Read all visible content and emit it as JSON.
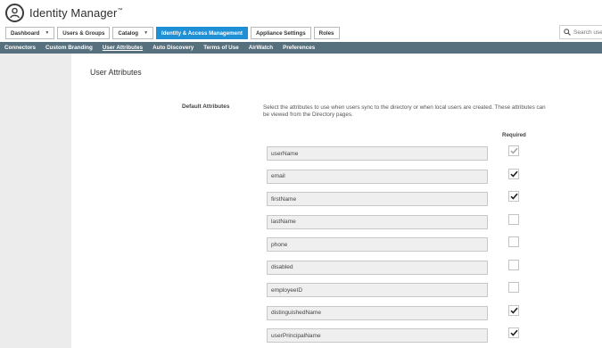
{
  "app": {
    "title": "Identity Manager",
    "trademark": "™"
  },
  "search": {
    "placeholder": "Search use"
  },
  "tabs": [
    {
      "label": "Dashboard",
      "dropdown": true
    },
    {
      "label": "Users & Groups",
      "dropdown": false
    },
    {
      "label": "Catalog",
      "dropdown": true
    },
    {
      "label": "Identity & Access Management",
      "dropdown": false,
      "active": true
    },
    {
      "label": "Appliance Settings",
      "dropdown": false
    },
    {
      "label": "Roles",
      "dropdown": false
    }
  ],
  "subnav": [
    {
      "label": "Connectors"
    },
    {
      "label": "Custom Branding"
    },
    {
      "label": "User Attributes",
      "active": true
    },
    {
      "label": "Auto Discovery"
    },
    {
      "label": "Terms of Use"
    },
    {
      "label": "AirWatch"
    },
    {
      "label": "Preferences"
    }
  ],
  "page": {
    "title": "User Attributes",
    "section_label": "Default Attributes",
    "description": "Select the attributes to use when users sync to the directory or when local users are created. These attributes can be viewed from the Directory pages.",
    "required_header": "Required"
  },
  "attributes": [
    {
      "name": "userName",
      "checked": true,
      "disabled": true
    },
    {
      "name": "email",
      "checked": true,
      "disabled": false
    },
    {
      "name": "firstName",
      "checked": true,
      "disabled": false
    },
    {
      "name": "lastName",
      "checked": false,
      "disabled": false
    },
    {
      "name": "phone",
      "checked": false,
      "disabled": false
    },
    {
      "name": "disabled",
      "checked": false,
      "disabled": false
    },
    {
      "name": "employeeID",
      "checked": false,
      "disabled": false
    },
    {
      "name": "distinguishedName",
      "checked": true,
      "disabled": false
    },
    {
      "name": "userPrincipalName",
      "checked": true,
      "disabled": false
    }
  ],
  "colors": {
    "active_tab": "#1f8fd6",
    "subnav_bg": "#56707d",
    "sidebar_bg": "#ececec"
  }
}
